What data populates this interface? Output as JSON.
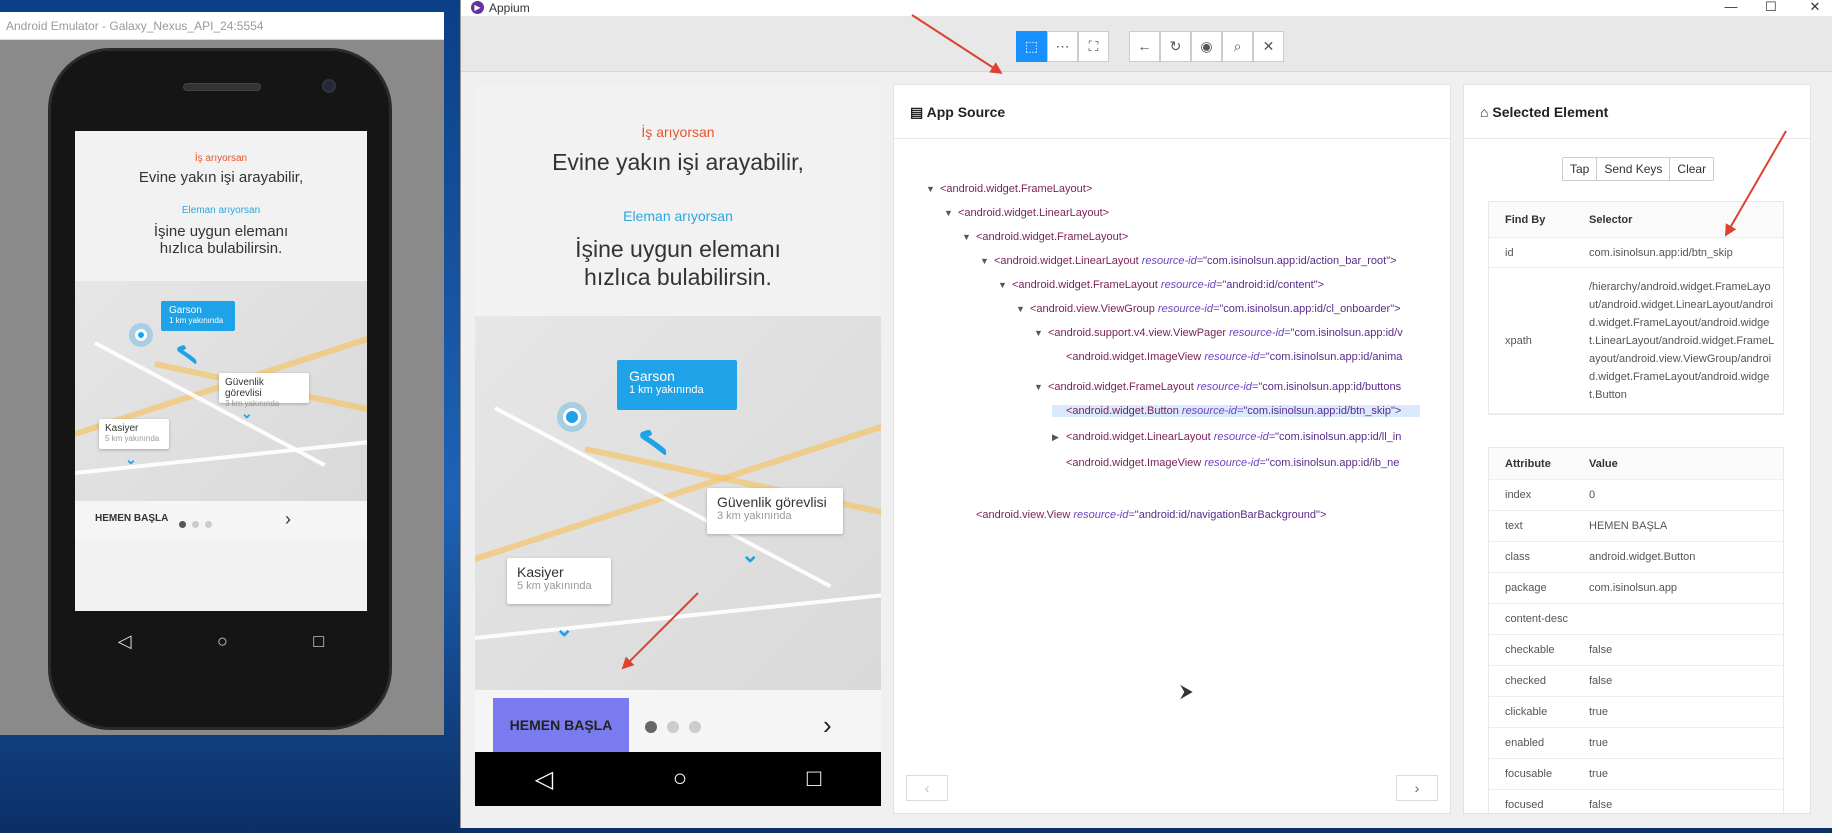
{
  "emulator": {
    "title": "Android Emulator - Galaxy_Nexus_API_24:5554"
  },
  "app_screen": {
    "job_seek": "İş arıyorsan",
    "job_seek_text": "Evine yakın işi arayabilir,",
    "employer": "Eleman arıyorsan",
    "employer_text_1": "İşine uygun elemanı",
    "employer_text_2": "hızlıca bulabilirsin.",
    "pins": [
      {
        "title": "Garson",
        "sub": "1 km yakınında"
      },
      {
        "title": "Güvenlik görevlisi",
        "sub": "3 km yakınında"
      },
      {
        "title": "Kasiyer",
        "sub": "5 km yakınında"
      }
    ],
    "start_button": "HEMEN BAŞLA",
    "next_arrow": "›",
    "nav_back": "◁",
    "nav_home": "○",
    "nav_recent": "□"
  },
  "appium": {
    "title": "Appium",
    "window_controls": {
      "minimize": "—",
      "maximize": "☐",
      "close": "✕"
    },
    "toolbar": [
      {
        "name": "select-icon",
        "glyph": "⬚",
        "active": true
      },
      {
        "name": "swipe-icon",
        "glyph": "⋯",
        "active": false
      },
      {
        "name": "tap-coordinates-icon",
        "glyph": "⛶",
        "active": false
      },
      {
        "name": "back-icon",
        "glyph": "←",
        "active": false
      },
      {
        "name": "refresh-icon",
        "glyph": "↻",
        "active": false
      },
      {
        "name": "eye-icon",
        "glyph": "◉",
        "active": false
      },
      {
        "name": "search-icon",
        "glyph": "⌕",
        "active": false
      },
      {
        "name": "close-icon",
        "glyph": "✕",
        "active": false
      }
    ],
    "app_source": {
      "header": "App Source",
      "tree": [
        {
          "arrow": "▼",
          "tag": "<android.widget.FrameLayout>",
          "attr": "",
          "val": ""
        },
        {
          "arrow": "▼",
          "tag": "<android.widget.LinearLayout>",
          "attr": "",
          "val": ""
        },
        {
          "arrow": "▼",
          "tag": "<android.widget.FrameLayout>",
          "attr": "",
          "val": ""
        },
        {
          "arrow": "▼",
          "tag": "<android.widget.LinearLayout",
          "attr": "resource-id=",
          "val": "\"com.isinolsun.app:id/action_bar_root\">"
        },
        {
          "arrow": "▼",
          "tag": "<android.widget.FrameLayout",
          "attr": "resource-id=",
          "val": "\"android:id/content\">"
        },
        {
          "arrow": "▼",
          "tag": "<android.view.ViewGroup",
          "attr": "resource-id=",
          "val": "\"com.isinolsun.app:id/cl_onboarder\">"
        },
        {
          "arrow": "▼",
          "tag": "<android.support.v4.view.ViewPager",
          "attr": "resource-id=",
          "val": "\"com.isinolsun.app:id/v"
        },
        {
          "arrow": "",
          "tag": "<android.widget.ImageView",
          "attr": "resource-id=",
          "val": "\"com.isinolsun.app:id/anima"
        },
        {
          "arrow": "▼",
          "tag": "<android.widget.FrameLayout",
          "attr": "resource-id=",
          "val": "\"com.isinolsun.app:id/buttons"
        },
        {
          "arrow": "",
          "tag": "<android.widget.Button",
          "attr": "resource-id=",
          "val": "\"com.isinolsun.app:id/btn_skip\">"
        },
        {
          "arrow": "▶",
          "tag": "<android.widget.LinearLayout",
          "attr": "resource-id=",
          "val": "\"com.isinolsun.app:id/ll_in"
        },
        {
          "arrow": "",
          "tag": "<android.widget.ImageView",
          "attr": "resource-id=",
          "val": "\"com.isinolsun.app:id/ib_ne"
        },
        {
          "arrow": "",
          "tag": "<android.view.View",
          "attr": "resource-id=",
          "val": "\"android:id/navigationBarBackground\">"
        }
      ],
      "prev": "‹",
      "next": "›"
    },
    "selected_element": {
      "header": "Selected Element",
      "actions": [
        "Tap",
        "Send Keys",
        "Clear"
      ],
      "find_by_header": [
        "Find By",
        "Selector"
      ],
      "find_by": [
        {
          "key": "id",
          "value": "com.isinolsun.app:id/btn_skip"
        },
        {
          "key": "xpath",
          "value": "/hierarchy/android.widget.FrameLayout/android.widget.LinearLayout/android.widget.FrameLayout/android.widget.LinearLayout/android.widget.FrameLayout/android.view.ViewGroup/android.widget.FrameLayout/android.widget.Button"
        }
      ],
      "attr_header": [
        "Attribute",
        "Value"
      ],
      "attributes": [
        {
          "key": "index",
          "value": "0"
        },
        {
          "key": "text",
          "value": "HEMEN BAŞLA"
        },
        {
          "key": "class",
          "value": "android.widget.Button"
        },
        {
          "key": "package",
          "value": "com.isinolsun.app"
        },
        {
          "key": "content-desc",
          "value": ""
        },
        {
          "key": "checkable",
          "value": "false"
        },
        {
          "key": "checked",
          "value": "false"
        },
        {
          "key": "clickable",
          "value": "true"
        },
        {
          "key": "enabled",
          "value": "true"
        },
        {
          "key": "focusable",
          "value": "true"
        },
        {
          "key": "focused",
          "value": "false"
        }
      ]
    }
  },
  "colors": {
    "accent": "#1890ff",
    "annotation_arrow": "#d9432f",
    "highlight_button": "#7b7bf0",
    "orange_text": "#e4572e",
    "blue_text": "#2aa7e0"
  }
}
